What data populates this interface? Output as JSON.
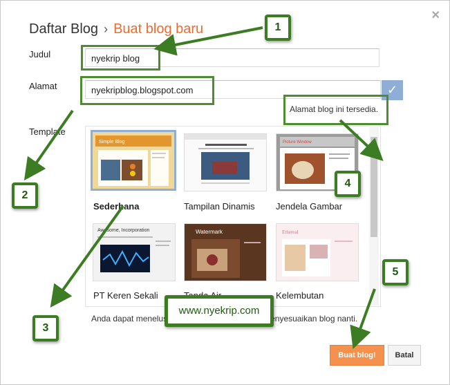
{
  "header": {
    "breadcrumb_parent": "Daftar Blog",
    "separator": "›",
    "current": "Buat blog baru",
    "close_symbol": "×"
  },
  "form": {
    "title_label": "Judul",
    "title_value": "nyekrip blog",
    "address_label": "Alamat",
    "address_value": "nyekripblog.blogspot.com",
    "address_hint": "Alamat blog ini tersedia.",
    "template_label": "Template"
  },
  "templates": [
    {
      "name": "Sederhana",
      "selected": true
    },
    {
      "name": "Tampilan Dinamis",
      "selected": false
    },
    {
      "name": "Jendela Gambar",
      "selected": false
    },
    {
      "name": "PT Keren Sekali",
      "selected": false
    },
    {
      "name": "Tanda Air",
      "selected": false
    },
    {
      "name": "Kelembutan",
      "selected": false
    }
  ],
  "thumb_text": {
    "simple": "Simple Blog",
    "picture": "Picture Window",
    "awesome": "Awesome, Incorporation",
    "watermark": "Watermark",
    "ethereal": "Ethereal"
  },
  "note_left": "Anda dapat menelus",
  "note_right": "n menyesuaikan blog nanti.",
  "buttons": {
    "create": "Buat blog!",
    "cancel": "Batal"
  },
  "annotations": {
    "badges": [
      "1",
      "2",
      "3",
      "4",
      "5"
    ],
    "watermark_text": "www.nyekrip.com"
  },
  "colors": {
    "accent": "#ee6b2f",
    "primary_button": "#f5904d",
    "annotation_green": "#3c7c22",
    "check_blue": "#8eaed5"
  }
}
